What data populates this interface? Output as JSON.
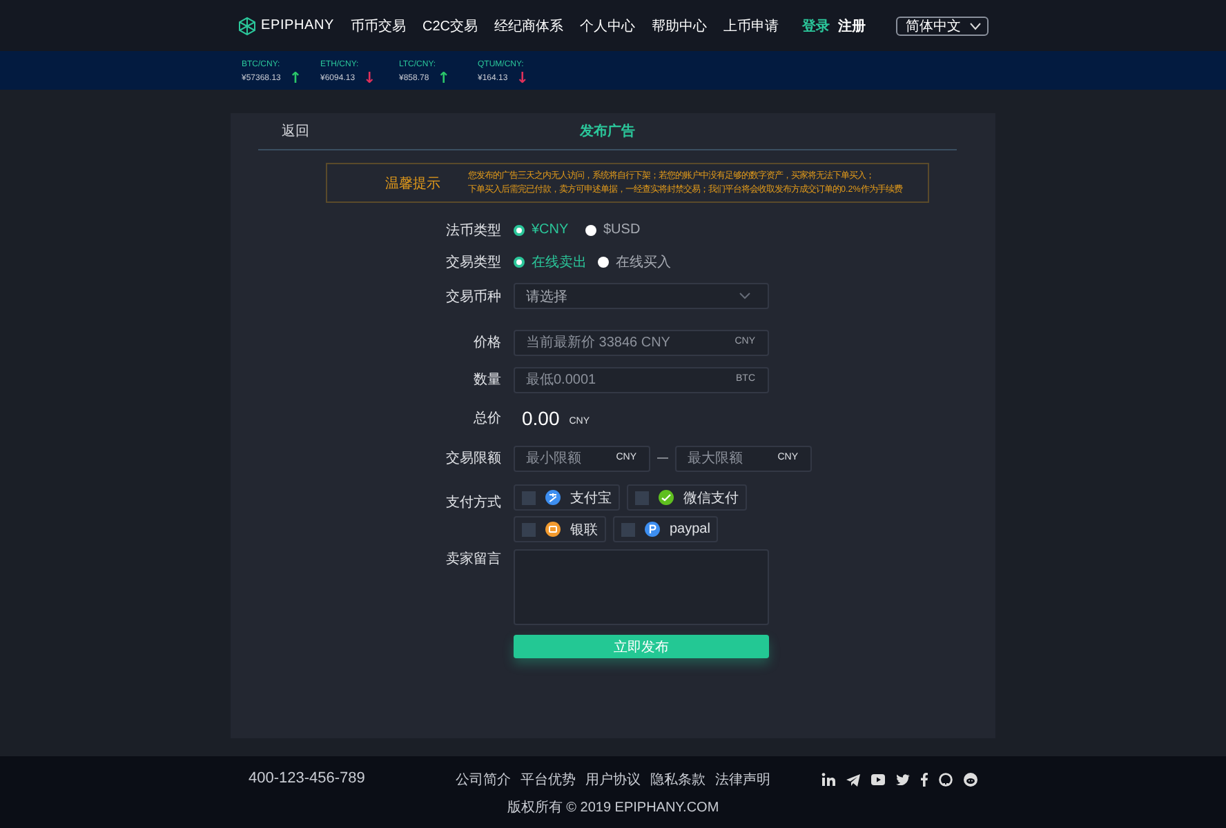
{
  "header": {
    "logo": "EPIPHANY",
    "nav": [
      "币币交易",
      "C2C交易",
      "经纪商体系",
      "个人中心",
      "帮助中心",
      "上币申请"
    ],
    "login": "登录",
    "register": "注册",
    "language": "简体中文"
  },
  "ticker": [
    {
      "pair": "BTC/CNY:",
      "price": "¥57368.13",
      "arrow": "↑",
      "color": "#2bc66a"
    },
    {
      "pair": "ETH/CNY:",
      "price": "¥6094.13",
      "arrow": "↓",
      "color": "#e0305a"
    },
    {
      "pair": "LTC/CNY:",
      "price": "¥858.78",
      "arrow": "↑",
      "color": "#2bc66a"
    },
    {
      "pair": "QTUM/CNY:",
      "price": "¥164.13",
      "arrow": "↓",
      "color": "#e0305a"
    }
  ],
  "page": {
    "back": "返回",
    "title": "发布广告"
  },
  "notice": {
    "label": "温馨提示",
    "lines": [
      "您发布的广告三天之内无人访问，系统将自行下架；若您的账户中没有足够的数字资产，买家将无法下单买入；",
      "下单买入后需完已付款，卖方可申述单据，一经查实将封禁交易；我们平台将会收取发布方成交订单的0.2%作为手续费"
    ]
  },
  "form": {
    "currency": {
      "label": "法币类型",
      "options": [
        {
          "label": "¥CNY",
          "selected": true
        },
        {
          "label": "$USD",
          "selected": false
        }
      ]
    },
    "trade_type": {
      "label": "交易类型",
      "options": [
        {
          "label": "在线卖出",
          "selected": true
        },
        {
          "label": "在线买入",
          "selected": false
        }
      ]
    },
    "coin": {
      "label": "交易币种",
      "placeholder": "请选择"
    },
    "price": {
      "label": "价格",
      "placeholder": "当前最新价 33846 CNY",
      "unit": "CNY"
    },
    "amount": {
      "label": "数量",
      "placeholder": "最低0.0001",
      "unit": "BTC"
    },
    "total": {
      "label": "总价",
      "value": "0.00",
      "unit": "CNY"
    },
    "limit": {
      "label": "交易限额",
      "min_placeholder": "最小限额",
      "min_unit": "CNY",
      "separator": "—",
      "max_placeholder": "最大限额",
      "max_unit": "CNY"
    },
    "payment": {
      "label": "支付方式",
      "options": [
        {
          "label": "支付宝",
          "kind": "alipay",
          "checked": false
        },
        {
          "label": "微信支付",
          "kind": "wechat",
          "checked": false
        },
        {
          "label": "银联",
          "kind": "unionpay",
          "checked": false
        },
        {
          "label": "paypal",
          "kind": "paypal",
          "checked": false
        }
      ]
    },
    "message": {
      "label": "卖家留言"
    },
    "submit": "立即发布"
  },
  "footer": {
    "phone": "400-123-456-789",
    "links": [
      "公司简介",
      "平台优势",
      "用户协议",
      "隐私条款",
      "法律声明"
    ],
    "copyright": "版权所有 © 2019 EPIPHANY.COM",
    "social": [
      {
        "kind": "linkedin"
      },
      {
        "kind": "telegram"
      },
      {
        "kind": "youtube"
      },
      {
        "kind": "twitter"
      },
      {
        "kind": "facebook"
      },
      {
        "kind": "github"
      },
      {
        "kind": "reddit"
      }
    ]
  }
}
